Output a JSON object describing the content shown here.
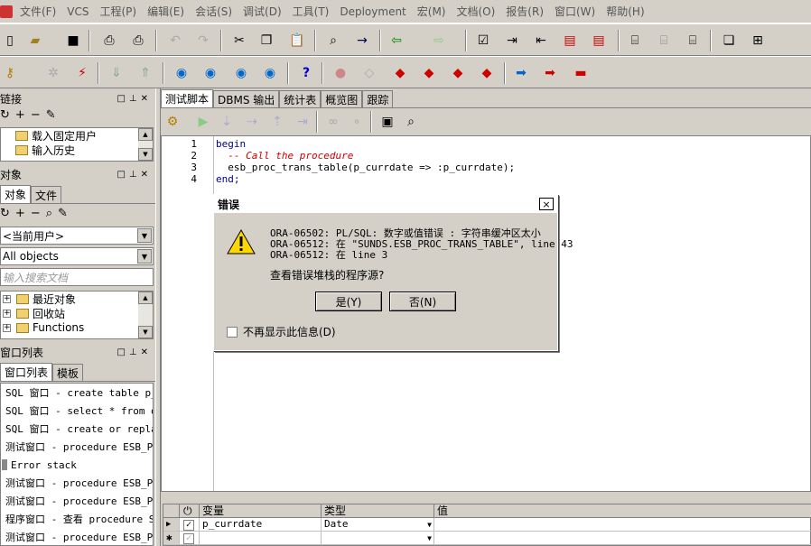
{
  "menu": [
    "文件(F)",
    "VCS",
    "工程(P)",
    "编辑(E)",
    "会话(S)",
    "调试(D)",
    "工具(T)",
    "Deployment",
    "宏(M)",
    "文档(O)",
    "报告(R)",
    "窗口(W)",
    "帮助(H)"
  ],
  "panels": {
    "connections": {
      "title": "链接",
      "items": [
        "载入固定用户",
        "输入历史"
      ]
    },
    "objects": {
      "title": "对象",
      "tabs": [
        "对象",
        "文件"
      ],
      "user_combo": "<当前用户>",
      "filter_combo": "All objects",
      "search_placeholder": "输入搜索文档",
      "items": [
        "最近对象",
        "回收站",
        "Functions"
      ]
    },
    "windows": {
      "title": "窗口列表",
      "tabs": [
        "窗口列表",
        "模板"
      ],
      "items": [
        "SQL 窗口 - create table p_s",
        "SQL 窗口 - select * from db",
        "SQL 窗口 - create or replac",
        "测试窗口 - procedure ESB_PR",
        "Error stack",
        "测试窗口 - procedure ESB_PR",
        "测试窗口 - procedure ESB_PR",
        "程序窗口 - 查看 procedure S",
        "测试窗口 - procedure ESB_PR"
      ]
    }
  },
  "main_tabs": [
    "测试脚本",
    "DBMS 输出",
    "统计表",
    "概览图",
    "跟踪"
  ],
  "code": {
    "line_numbers": [
      "1",
      "2",
      "3",
      "4"
    ],
    "lines": [
      "begin",
      "  -- Call the procedure",
      "  esb_proc_trans_table(p_currdate => :p_currdate);",
      "end;"
    ]
  },
  "dialog": {
    "title": "错误",
    "messages": [
      "ORA-06502: PL/SQL: 数字或值错误 :  字符串缓冲区太小",
      "ORA-06512: 在 \"SUNDS.ESB_PROC_TRANS_TABLE\", line 43",
      "ORA-06512: 在 line 3"
    ],
    "question": "查看错误堆栈的程序源?",
    "yes_label": "是(Y)",
    "no_label": "否(N)",
    "dont_show_label": "不再显示此信息(D)",
    "close_glyph": "×"
  },
  "grid": {
    "headers": [
      "变量",
      "类型",
      "值"
    ],
    "rows": [
      {
        "name": "p_currdate",
        "type": "Date",
        "value": ""
      }
    ]
  }
}
